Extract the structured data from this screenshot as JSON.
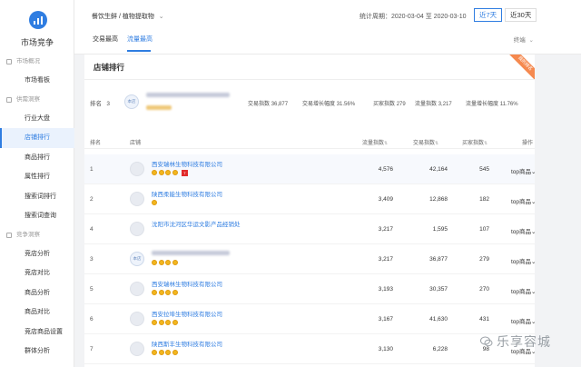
{
  "sidebar": {
    "title": "市场竞争",
    "groups": [
      {
        "label": "市场概况",
        "items": [
          "市场看板"
        ]
      },
      {
        "label": "供需洞察",
        "items": [
          "行业大盘",
          "店铺排行",
          "商品排行",
          "属性排行",
          "搜索词排行",
          "搜索词查询"
        ]
      },
      {
        "label": "竞争洞察",
        "items": [
          "竞店分析",
          "竞店对比",
          "商品分析",
          "商品对比",
          "竞店商品设置",
          "群体分析"
        ]
      }
    ],
    "active_item": "店铺排行"
  },
  "topbar": {
    "breadcrumb": "餐饮生鲜 / 植物提取物",
    "period_label": "统计周期：",
    "period_value": "2020-03-04 至 2020-03-10",
    "btn_7": "近7天",
    "btn_30": "近30天",
    "tabs": [
      "交易最高",
      "流量最高"
    ],
    "active_tab": "流量最高",
    "terminal": "终端"
  },
  "card": {
    "title": "店铺排行",
    "ribbon": "我的排名"
  },
  "myshop": {
    "rank_label": "排名",
    "rank_value": "3",
    "badge": "本店",
    "m1_label": "交易指数",
    "m1_value": "36,877",
    "m2_label": "交易增长幅度",
    "m2_value": "31.56%",
    "m3_label": "买家指数",
    "m3_value": "279",
    "m4_label": "流量指数",
    "m4_value": "3,217",
    "m5_label": "流量增长幅度",
    "m5_value": "11.76%"
  },
  "table": {
    "headers": {
      "rank": "排名",
      "shop": "店铺",
      "traffic": "流量指数",
      "trade": "交易指数",
      "buyer": "买家指数",
      "op": "操作"
    },
    "rows": [
      {
        "rank": "1",
        "name": "西安瑞林生物科技有限公司",
        "crowns": 4,
        "tmall": true,
        "traffic": "4,576",
        "trade": "42,164",
        "buyer": "545",
        "op": "top商品"
      },
      {
        "rank": "2",
        "name": "陕西柔能生物科技有限公司",
        "crowns": 1,
        "tmall": false,
        "traffic": "3,409",
        "trade": "12,868",
        "buyer": "182",
        "op": "top商品"
      },
      {
        "rank": "4",
        "name": "沈阳市沈河区华运文影产品经销处",
        "crowns": 0,
        "tmall": false,
        "traffic": "3,217",
        "trade": "1,595",
        "buyer": "107",
        "op": "top商品"
      },
      {
        "rank": "3",
        "name": "",
        "crowns": 4,
        "tmall": false,
        "traffic": "3,217",
        "trade": "36,877",
        "buyer": "279",
        "op": "top商品",
        "is_mine": true,
        "badge": "本店"
      },
      {
        "rank": "5",
        "name": "西安瑞林生物科技有限公司",
        "crowns": 4,
        "tmall": false,
        "traffic": "3,193",
        "trade": "30,357",
        "buyer": "270",
        "op": "top商品"
      },
      {
        "rank": "6",
        "name": "西安拉埠生物科技有限公司",
        "crowns": 4,
        "tmall": false,
        "traffic": "3,167",
        "trade": "41,630",
        "buyer": "431",
        "op": "top商品"
      },
      {
        "rank": "7",
        "name": "陕西斯丰生物科技有限公司",
        "crowns": 4,
        "tmall": false,
        "traffic": "3,130",
        "trade": "6,228",
        "buyer": "98",
        "op": "top商品"
      }
    ]
  },
  "watermark": "乐享容城",
  "colors": {
    "accent": "#2f7de1",
    "ribbon": "#f5894f",
    "crown": "#f2b61f",
    "tmall": "#e12b2b"
  }
}
